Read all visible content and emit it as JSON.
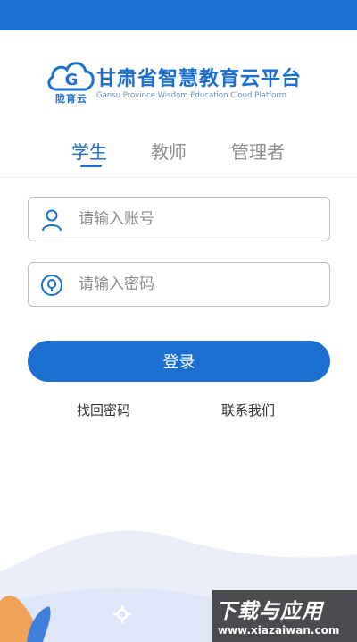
{
  "brand": {
    "logo_sub": "陇育云",
    "title": "甘肃省智慧教育云平台",
    "subtitle_en": "Gansu Province Wisdom Education Cloud Platform"
  },
  "tabs": [
    {
      "label": "学生",
      "active": true
    },
    {
      "label": "教师",
      "active": false
    },
    {
      "label": "管理者",
      "active": false
    }
  ],
  "form": {
    "account_placeholder": "请输入账号",
    "password_placeholder": "请输入密码",
    "login_label": "登录"
  },
  "links": {
    "forgot_password": "找回密码",
    "contact_us": "联系我们"
  },
  "icons": {
    "account": "user-icon",
    "password": "lock-icon",
    "logo": "cloud-logo-icon",
    "settings": "gear-icon"
  },
  "colors": {
    "primary": "#1a6fd0",
    "tab_inactive": "#8c8c8c",
    "field_border": "#bfbfbf"
  },
  "watermark": {
    "main": "下载与应用",
    "url": "www.xiazaiwan.com"
  }
}
